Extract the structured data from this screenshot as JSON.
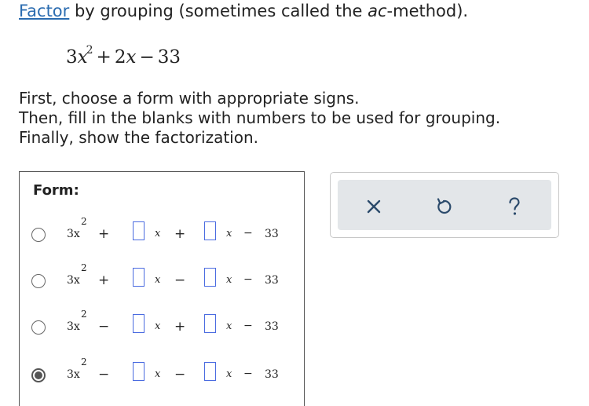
{
  "instruction": {
    "link_text": "Factor",
    "text_before_ac": " by grouping (sometimes called the ",
    "ac_text": "ac",
    "text_after_ac": "-method)."
  },
  "polynomial": {
    "lead_coef": "3",
    "var": "x",
    "exponent": "2",
    "op1": "+",
    "mid_term": "2",
    "mid_var": "x",
    "op2": "−",
    "const": "33"
  },
  "steps": [
    "First, choose a form with appropriate signs.",
    "Then, fill in the blanks with numbers to be used for grouping.",
    "Finally, show the factorization."
  ],
  "form": {
    "title": "Form:",
    "options": [
      {
        "coef": "3x",
        "exp": "2",
        "sign1": "+",
        "x1": "x",
        "sign2": "+",
        "x2": "x",
        "sign3": "−",
        "const": "33",
        "selected": false
      },
      {
        "coef": "3x",
        "exp": "2",
        "sign1": "+",
        "x1": "x",
        "sign2": "−",
        "x2": "x",
        "sign3": "−",
        "const": "33",
        "selected": false
      },
      {
        "coef": "3x",
        "exp": "2",
        "sign1": "−",
        "x1": "x",
        "sign2": "+",
        "x2": "x",
        "sign3": "−",
        "const": "33",
        "selected": false
      },
      {
        "coef": "3x",
        "exp": "2",
        "sign1": "−",
        "x1": "x",
        "sign2": "−",
        "x2": "x",
        "sign3": "−",
        "const": "33",
        "selected": true
      }
    ]
  },
  "toolbar": {
    "buttons": [
      {
        "icon": "close-icon"
      },
      {
        "icon": "undo-icon"
      },
      {
        "icon": "help-icon"
      }
    ],
    "icon_color": "#2b4a6b",
    "panel_color": "#e3e6e9"
  }
}
